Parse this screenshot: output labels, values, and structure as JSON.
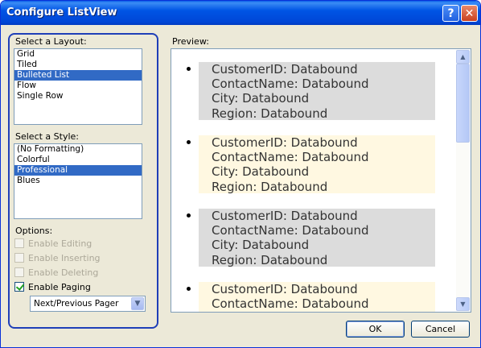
{
  "window": {
    "title": "Configure ListView",
    "help_glyph": "?",
    "close_glyph": "✕"
  },
  "layout": {
    "label": "Select a Layout:",
    "items": [
      "Grid",
      "Tiled",
      "Bulleted List",
      "Flow",
      "Single Row"
    ],
    "selected": "Bulleted List"
  },
  "style": {
    "label": "Select a Style:",
    "items": [
      "(No Formatting)",
      "Colorful",
      "Professional",
      "Blues"
    ],
    "selected": "Professional"
  },
  "options": {
    "label": "Options:",
    "enable_editing": {
      "label": "Enable Editing",
      "checked": false,
      "enabled": false
    },
    "enable_inserting": {
      "label": "Enable Inserting",
      "checked": false,
      "enabled": false
    },
    "enable_deleting": {
      "label": "Enable Deleting",
      "checked": false,
      "enabled": false
    },
    "enable_paging": {
      "label": "Enable Paging",
      "checked": true,
      "enabled": true
    },
    "pager": {
      "value": "Next/Previous Pager"
    }
  },
  "preview": {
    "label": "Preview:",
    "items": [
      {
        "lines": [
          "CustomerID: Databound",
          "ContactName: Databound",
          "City: Databound",
          "Region: Databound"
        ],
        "bg": "#dcdcdc"
      },
      {
        "lines": [
          "CustomerID: Databound",
          "ContactName: Databound",
          "City: Databound",
          "Region: Databound"
        ],
        "bg": "#fff8e1"
      },
      {
        "lines": [
          "CustomerID: Databound",
          "ContactName: Databound",
          "City: Databound",
          "Region: Databound"
        ],
        "bg": "#dcdcdc"
      },
      {
        "lines": [
          "CustomerID: Databound",
          "ContactName: Databound"
        ],
        "bg": "#fff8e1"
      }
    ]
  },
  "buttons": {
    "ok": "OK",
    "cancel": "Cancel"
  },
  "colors": {
    "selection": "#316ac5",
    "title_bar": "#0055e5"
  }
}
